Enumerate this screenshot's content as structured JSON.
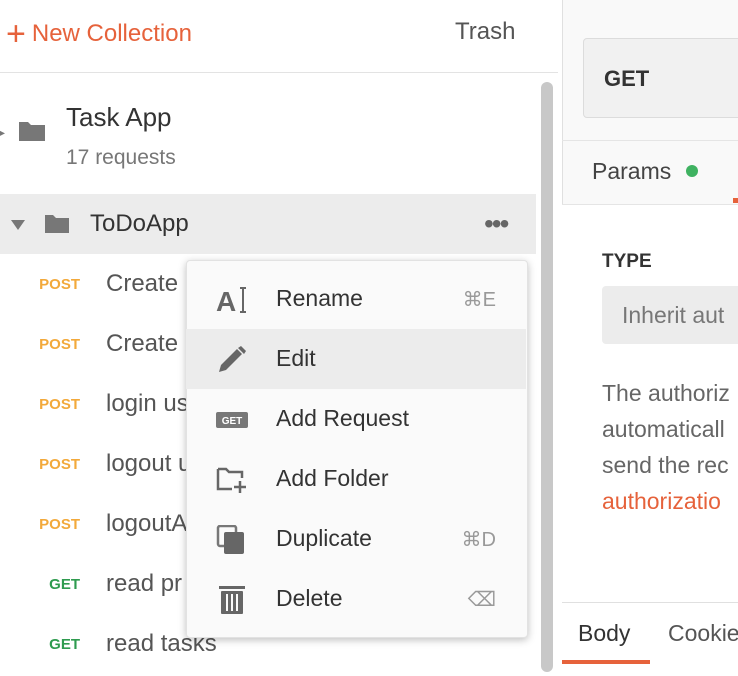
{
  "sidebar": {
    "new_collection_label": "New Collection",
    "trash_label": "Trash",
    "collections": [
      {
        "title": "Task App",
        "count": "17 requests"
      },
      {
        "title": "ToDoApp",
        "more": "•••"
      }
    ],
    "requests": [
      {
        "method": "POST",
        "name": "Create"
      },
      {
        "method": "POST",
        "name": "Create"
      },
      {
        "method": "POST",
        "name": "login us"
      },
      {
        "method": "POST",
        "name": "logout u"
      },
      {
        "method": "POST",
        "name": "logoutA"
      },
      {
        "method": "GET",
        "name": "read pr"
      },
      {
        "method": "GET",
        "name": "read tasks"
      }
    ]
  },
  "context_menu": {
    "items": [
      {
        "label": "Rename",
        "shortcut": "⌘E",
        "icon": "rename-icon"
      },
      {
        "label": "Edit",
        "shortcut": "",
        "icon": "pencil-icon",
        "highlighted": true
      },
      {
        "label": "Add Request",
        "shortcut": "",
        "icon": "get-request-icon",
        "badge": "GET"
      },
      {
        "label": "Add Folder",
        "shortcut": "",
        "icon": "add-folder-icon"
      },
      {
        "label": "Duplicate",
        "shortcut": "⌘D",
        "icon": "duplicate-icon"
      },
      {
        "label": "Delete",
        "shortcut": "⌫",
        "icon": "trash-icon"
      }
    ]
  },
  "request_pane": {
    "method": "GET",
    "tabs": {
      "params": "Params"
    },
    "auth": {
      "type_label": "TYPE",
      "type_value": "Inherit aut",
      "desc_lines": [
        "The authoriz",
        "automaticall",
        "send the rec"
      ],
      "link_text": "authorizatio"
    }
  },
  "response_tabs": {
    "body": "Body",
    "cookies": "Cookie"
  },
  "colors": {
    "accent": "#e6623b",
    "post": "#f2a93b",
    "get": "#2f9b4f",
    "status_dot": "#3fb261"
  }
}
